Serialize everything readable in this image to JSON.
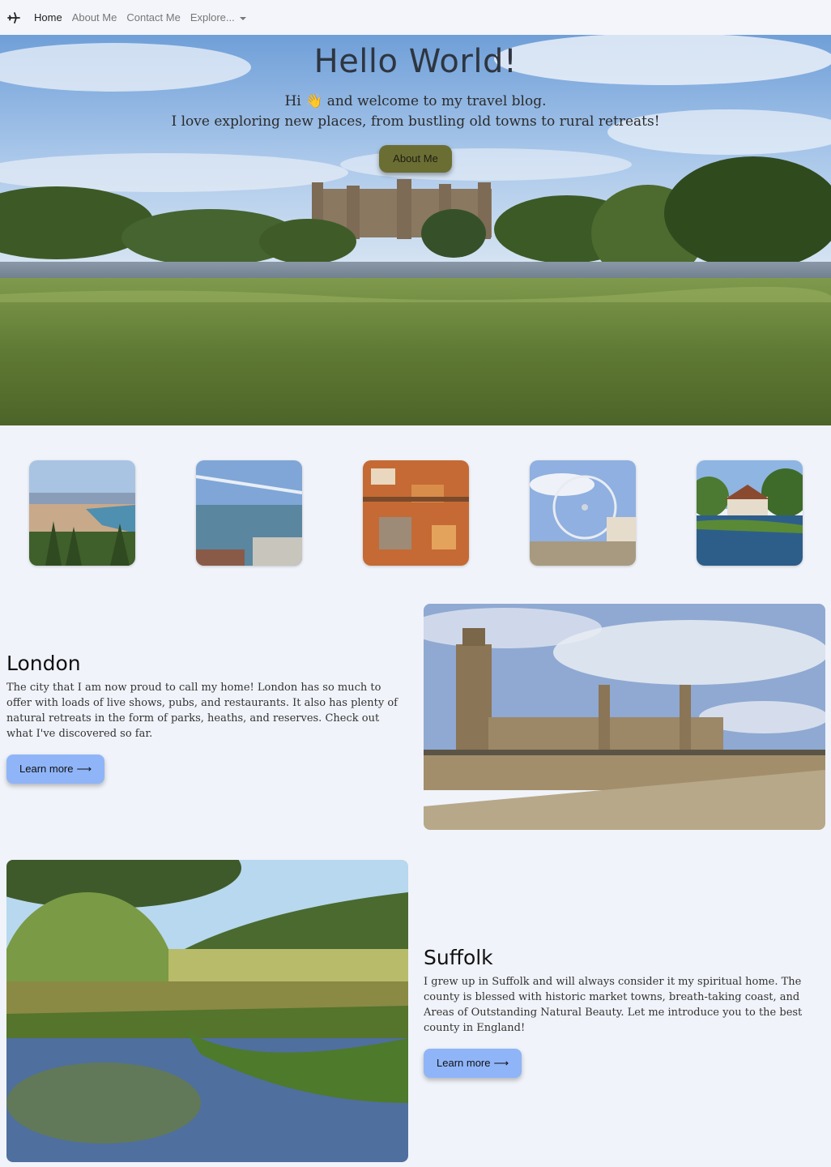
{
  "nav": {
    "brand_icon": "airplane-icon",
    "links": [
      "Home",
      "About Me",
      "Contact Me",
      "Explore..."
    ]
  },
  "hero": {
    "title": "Hello World!",
    "line1_pre": "Hi",
    "wave_emoji": "👋",
    "line1_post": "and welcome to my travel blog.",
    "line2": "I love exploring new places, from bustling old towns to rural retreats!",
    "button": "About Me"
  },
  "sections": {
    "london": {
      "title": "London",
      "text": "The city that I am now proud to call my home! London has so much to offer with loads of live shows, pubs, and restaurants. It also has plenty of natural retreats in the form of parks, heaths, and reserves. Check out what I've discovered so far.",
      "button": "Learn more",
      "arrow": "⟶"
    },
    "suffolk": {
      "title": "Suffolk",
      "text": "I grew up in Suffolk and will always consider it my spiritual home. The county is blessed with historic market towns, breath-taking coast, and Areas of Outstanding Natural Beauty. Let me introduce you to the best county in England!",
      "button": "Learn more",
      "arrow": "⟶"
    }
  },
  "colors": {
    "page_bg": "#f0f3f9",
    "hero_button": "#6b6e33",
    "learn_button": "#8fb5f8"
  }
}
